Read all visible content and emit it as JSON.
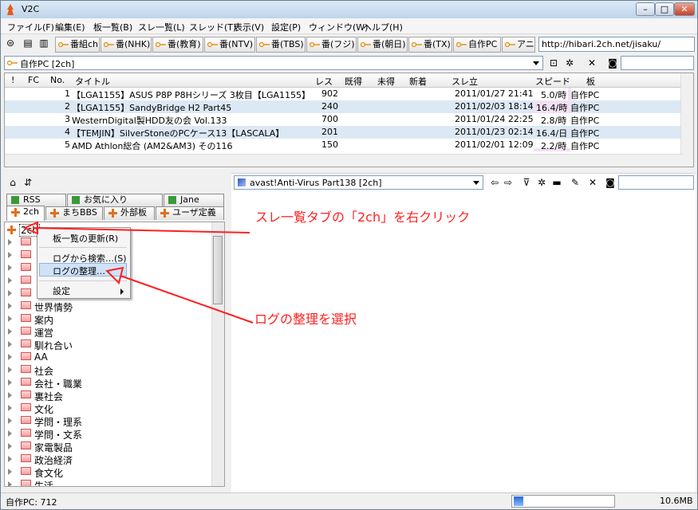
{
  "window": {
    "title": "V2C"
  },
  "menu": [
    "ファイル(F)",
    "編集(E)",
    "板一覧(B)",
    "スレ一覧(L)",
    "スレッド(T)",
    "表示(V)",
    "設定(P)",
    "ウィンドウ(W)",
    "ヘルプ(H)"
  ],
  "toolbar": {
    "buttons": [
      "番組ch",
      "番(NHK)",
      "番(教育)",
      "番(NTV)",
      "番(TBS)",
      "番(フジ)",
      "番(朝日)",
      "番(TX)",
      "自作PC",
      "アニメ"
    ],
    "url": "http://hibari.2ch.net/jisaku/"
  },
  "board_selector": {
    "value": "自作PC [2ch]"
  },
  "thread_list": {
    "headers": [
      "!",
      "FC",
      "No.",
      "タイトル",
      "レス",
      "既得",
      "未得",
      "新着",
      "スレ立",
      "スピード",
      "板"
    ],
    "rows": [
      {
        "no": "1",
        "title": "【LGA1155】ASUS P8P P8Hシリーズ 3枚目【LGA1155】",
        "res": "902",
        "date": "2011/01/27 21:41",
        "speed": "5.0/時",
        "board": "自作PC"
      },
      {
        "no": "2",
        "title": "【LGA1155】SandyBridge H2 Part45",
        "res": "240",
        "date": "2011/02/03 18:14",
        "speed": "16.4/時",
        "board": "自作PC"
      },
      {
        "no": "3",
        "title": "WesternDigital製HDD友の会 Vol.133",
        "res": "700",
        "date": "2011/01/24 22:25",
        "speed": "2.8/時",
        "board": "自作PC"
      },
      {
        "no": "4",
        "title": "【TEMJIN】SilverStoneのPCケース13【LASCALA】",
        "res": "201",
        "date": "2011/01/23 02:14",
        "speed": "16.4/日",
        "board": "自作PC"
      },
      {
        "no": "5",
        "title": "AMD Athlon総合 (AM2&AM3) その116",
        "res": "150",
        "date": "2011/02/01 12:09",
        "speed": "2.2/時",
        "board": "自作PC"
      }
    ]
  },
  "tabs": {
    "top": [
      "RSS",
      "お気に入り",
      "Jane"
    ],
    "bottom": [
      "2ch",
      "まちBBS",
      "外部板",
      "ユーザ定義"
    ]
  },
  "tree": {
    "root": "2ch",
    "items": [
      "世界情勢",
      "案内",
      "運営",
      "馴れ合い",
      "AA",
      "社会",
      "会社・職業",
      "裏社会",
      "文化",
      "学問・理系",
      "学問・文系",
      "家電製品",
      "政治経済",
      "食文化",
      "生活"
    ]
  },
  "context_menu": {
    "items": [
      "板一覧の更新(R)",
      "ログから検索…(S)",
      "ログの整理…",
      "設定"
    ]
  },
  "thread_selector": {
    "value": "avast!Anti-Virus Part138 [2ch]"
  },
  "annotations": {
    "right_click": "スレ一覧タブの「2ch」を右クリック",
    "select": "ログの整理を選択"
  },
  "status": {
    "left": "自作PC: 712",
    "memory": "10.6MB"
  },
  "colors": {
    "annotation": "#ff2020",
    "row_alt": "#dde8f5"
  }
}
